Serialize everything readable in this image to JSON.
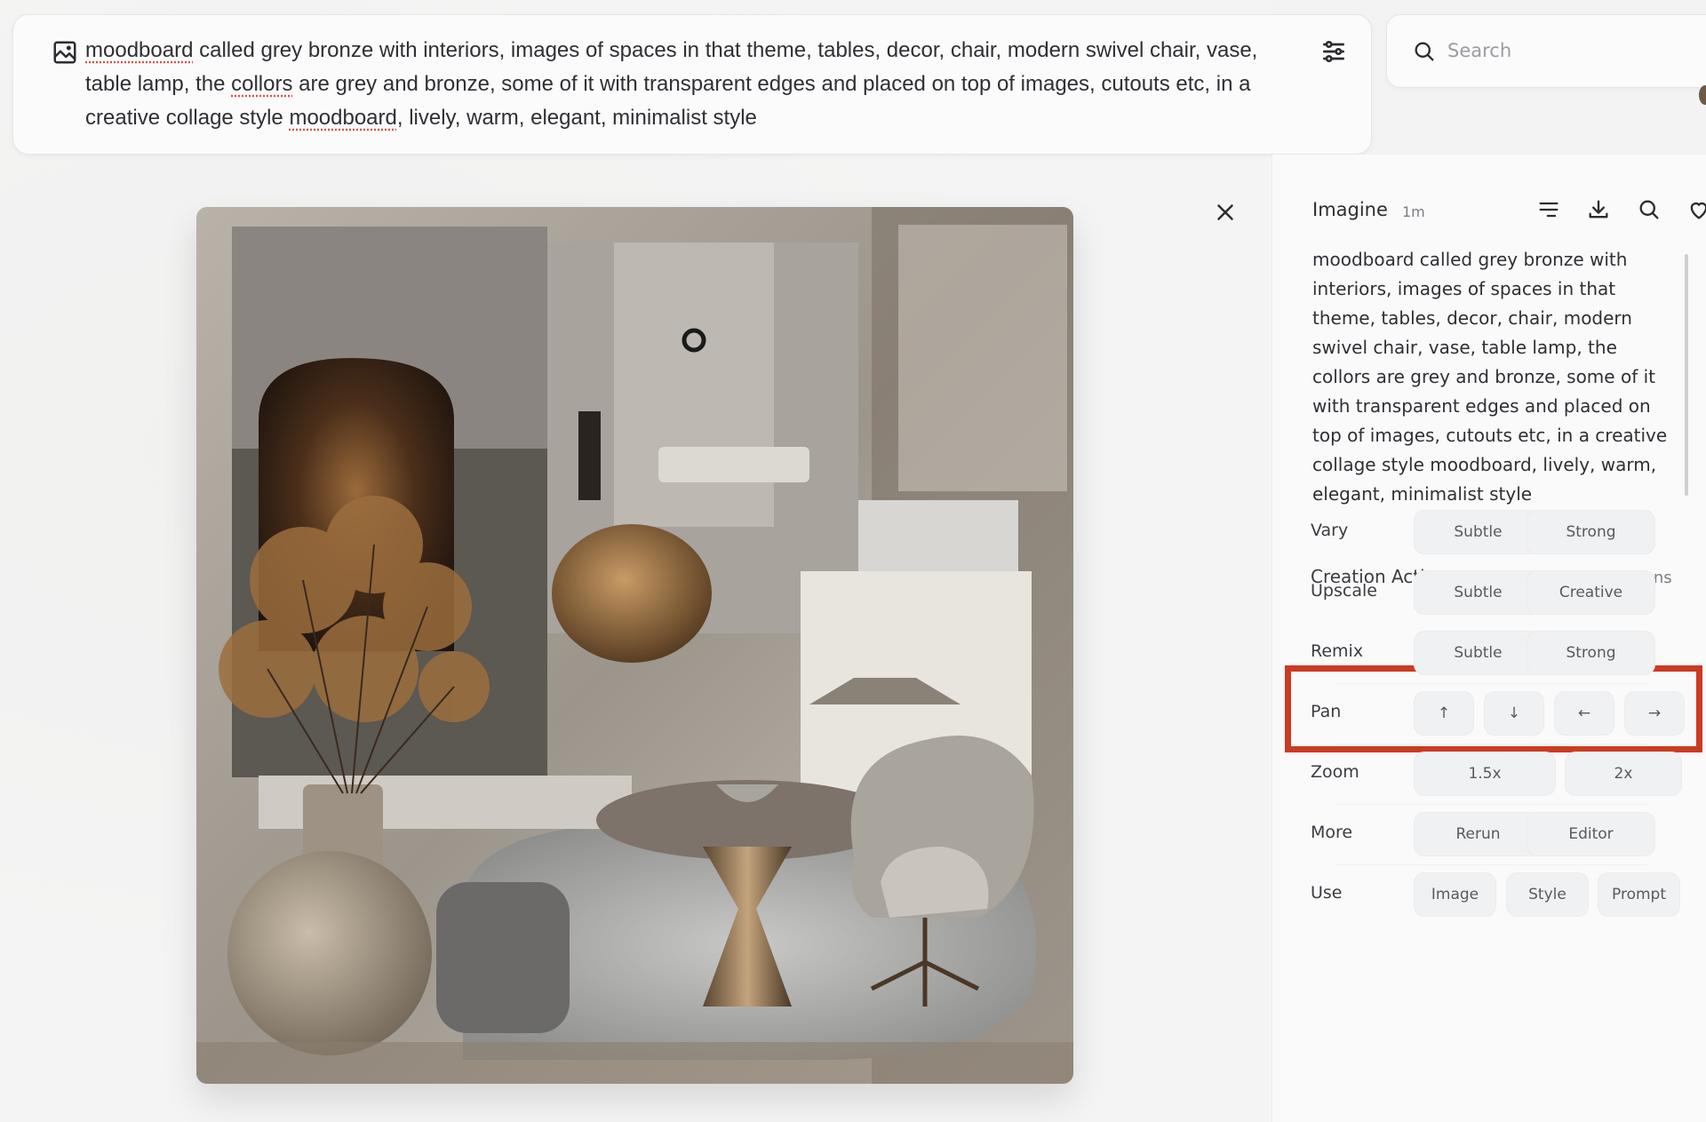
{
  "prompt_bar": {
    "segments": [
      {
        "text": "moodboard",
        "misspelled": true
      },
      {
        "text": " called grey bronze with interiors, images of spaces in that theme, tables, decor, chair, modern swivel chair, vase, table lamp, the ",
        "misspelled": false
      },
      {
        "text": "collors",
        "misspelled": true
      },
      {
        "text": " are grey and bronze, some of it with transparent edges and placed on top of images, cutouts etc, in a creative collage style ",
        "misspelled": false
      },
      {
        "text": "moodboard",
        "misspelled": true
      },
      {
        "text": ", lively, warm, elegant, minimalist style",
        "misspelled": false
      }
    ],
    "left_icon": "image-icon",
    "right_icon": "sliders-icon"
  },
  "search": {
    "placeholder": "Search",
    "value": "",
    "icon": "search-icon"
  },
  "viewer": {
    "image_alt": "Grey bronze interior moodboard collage",
    "close_icon": "close-icon"
  },
  "panel": {
    "title": "Imagine",
    "time": "1m",
    "icons": [
      "lines-menu-icon",
      "download-icon",
      "search-icon",
      "heart-icon"
    ],
    "description": "moodboard called grey bronze with interiors, images of spaces in that theme, tables, decor, chair, modern swivel chair, vase, table lamp, the collors are grey and bronze, some of it with transparent edges and placed on top of images, cutouts etc, in a creative collage style moodboard, lively, warm, elegant, minimalist style",
    "actions_title": "Creation Actions",
    "more_options": "More options",
    "rows": [
      {
        "label": "Vary",
        "buttons": [
          "Subtle",
          "Strong"
        ]
      },
      {
        "label": "Upscale",
        "buttons": [
          "Subtle",
          "Creative"
        ],
        "highlighted": true
      },
      {
        "label": "Remix",
        "buttons": [
          "Subtle",
          "Strong"
        ]
      },
      {
        "label": "Pan",
        "buttons": [
          "↑",
          "↓",
          "←",
          "→"
        ]
      },
      {
        "label": "Zoom",
        "buttons": [
          "1.5x",
          "2x"
        ]
      },
      {
        "label": "More",
        "buttons": [
          "Rerun",
          "Editor"
        ]
      },
      {
        "label": "Use",
        "buttons": [
          "Image",
          "Style",
          "Prompt"
        ]
      }
    ],
    "highlight_color": "#cb3b22"
  }
}
